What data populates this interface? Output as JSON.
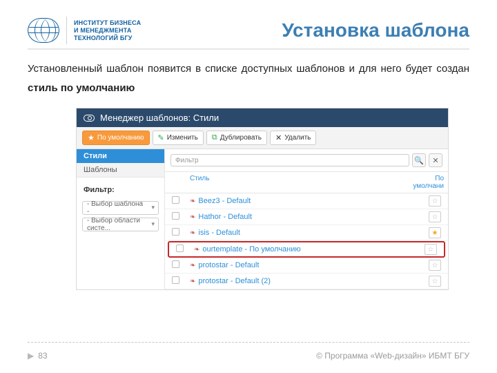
{
  "header": {
    "org_line1": "ИНСТИТУТ БИЗНЕСА",
    "org_line2": "И МЕНЕДЖМЕНТА",
    "org_line3": "ТЕХНОЛОГИЙ БГУ",
    "title": "Установка шаблона"
  },
  "lead": {
    "text_before": "Установленный шаблон появится в списке доступных шаблонов и для него будет создан ",
    "text_bold": "стиль по умолчанию"
  },
  "screenshot": {
    "window_title": "Менеджер шаблонов: Стили",
    "toolbar": {
      "default": "По умолчанию",
      "edit": "Изменить",
      "duplicate": "Дублировать",
      "delete": "Удалить"
    },
    "sidebar": {
      "tab_active": "Стили",
      "tab_other": "Шаблоны",
      "filter_heading": "Фильтр:",
      "select_template": "- Выбор шаблона -",
      "select_area": "- Выбор области систе..."
    },
    "filter": {
      "placeholder": "Фильтр"
    },
    "table": {
      "col_style": "Стиль",
      "col_default": "По умолчани",
      "rows": [
        {
          "name": "Beez3 - Default",
          "default": false,
          "highlight": false
        },
        {
          "name": "Hathor - Default",
          "default": false,
          "highlight": false
        },
        {
          "name": "isis - Default",
          "default": true,
          "highlight": false
        },
        {
          "name": "ourtemplate - По умолчанию",
          "default": false,
          "highlight": true
        },
        {
          "name": "protostar - Default",
          "default": false,
          "highlight": false
        },
        {
          "name": "protostar - Default (2)",
          "default": false,
          "highlight": false
        }
      ]
    }
  },
  "footer": {
    "page": "83",
    "copyright": "© Программа «Web-дизайн» ИБМТ БГУ"
  }
}
